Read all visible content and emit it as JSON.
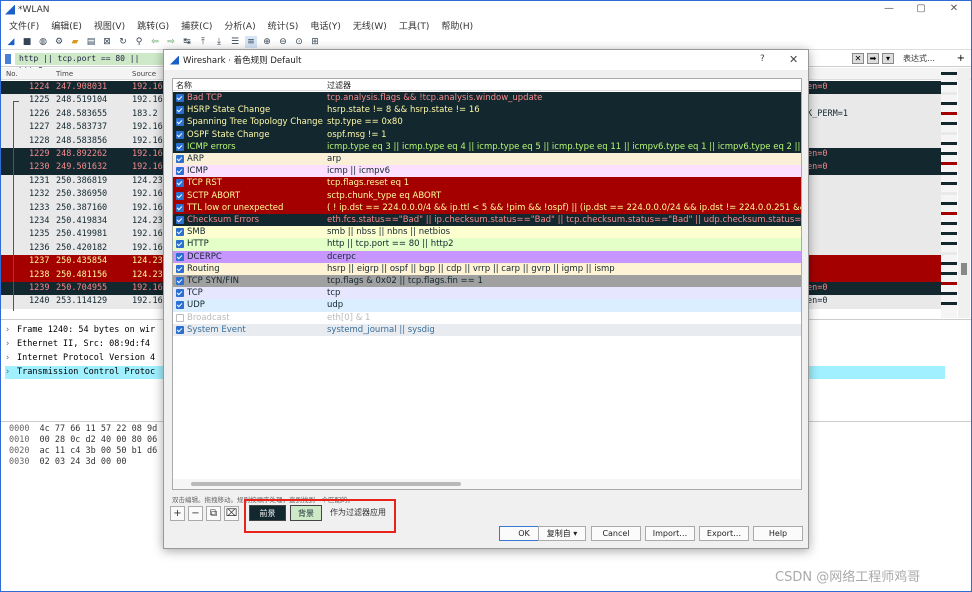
{
  "window": {
    "title": "*WLAN"
  },
  "menu": [
    "文件(F)",
    "编辑(E)",
    "视图(V)",
    "跳转(G)",
    "捕获(C)",
    "分析(A)",
    "统计(S)",
    "电话(Y)",
    "无线(W)",
    "工具(T)",
    "帮助(H)"
  ],
  "filter": {
    "value": "http || tcp.port == 80 || http2",
    "expression_label": "表达式…",
    "plus": "+"
  },
  "packet_headers": {
    "no": "No.",
    "time": "Time",
    "source": "Source"
  },
  "packets": [
    {
      "no": "1224",
      "time": "247.908031",
      "src": "192.16",
      "rx": "en=0",
      "style": "dark"
    },
    {
      "no": "1225",
      "time": "248.519104",
      "src": "192.16",
      "rx": "",
      "style": "gray"
    },
    {
      "no": "1226",
      "time": "248.583655",
      "src": "183.2",
      "rx": "K_PERM=1",
      "style": "gray"
    },
    {
      "no": "1227",
      "time": "248.583737",
      "src": "192.16",
      "rx": "",
      "style": "gray"
    },
    {
      "no": "1228",
      "time": "248.583856",
      "src": "192.16",
      "rx": "",
      "style": "gray"
    },
    {
      "no": "1229",
      "time": "248.892262",
      "src": "192.16",
      "rx": "en=0",
      "style": "dark"
    },
    {
      "no": "1230",
      "time": "249.501632",
      "src": "192.16",
      "rx": "en=0",
      "style": "dark"
    },
    {
      "no": "1231",
      "time": "250.386819",
      "src": "124.23",
      "rx": "",
      "style": "gray"
    },
    {
      "no": "1232",
      "time": "250.386950",
      "src": "192.16",
      "rx": "",
      "style": "gray"
    },
    {
      "no": "1233",
      "time": "250.387160",
      "src": "192.16",
      "rx": "",
      "style": "gray"
    },
    {
      "no": "1234",
      "time": "250.419834",
      "src": "124.23",
      "rx": "",
      "style": "gray"
    },
    {
      "no": "1235",
      "time": "250.419981",
      "src": "192.16",
      "rx": "",
      "style": "gray"
    },
    {
      "no": "1236",
      "time": "250.420182",
      "src": "192.16",
      "rx": "",
      "style": "gray"
    },
    {
      "no": "1237",
      "time": "250.435854",
      "src": "124.23",
      "rx": "",
      "style": "red"
    },
    {
      "no": "1238",
      "time": "250.481156",
      "src": "124.23",
      "rx": "",
      "style": "red"
    },
    {
      "no": "1239",
      "time": "250.704955",
      "src": "192.16",
      "rx": "en=0",
      "style": "dark"
    },
    {
      "no": "1240",
      "time": "253.114129",
      "src": "192.16",
      "rx": "en=0",
      "style": "gray"
    }
  ],
  "details": [
    {
      "text": "Frame 1240: 54 bytes on wir"
    },
    {
      "text": "Ethernet II, Src: 08:9d:f4"
    },
    {
      "text": "Internet Protocol Version 4"
    },
    {
      "text": "Transmission Control Protoc"
    }
  ],
  "hex": [
    {
      "off": "0000",
      "bytes": "4c 77 66 11 57 22 08 9d"
    },
    {
      "off": "0010",
      "bytes": "00 28 0c d2 40 00 80 06"
    },
    {
      "off": "0020",
      "bytes": "ac 11 c4 3b 00 50 b1 d6"
    },
    {
      "off": "0030",
      "bytes": "02 03 24 3d 00 00"
    }
  ],
  "dialog": {
    "title": "Wireshark · 着色规则 Default",
    "help": "?",
    "close": "✕",
    "col_name": "名称",
    "col_filter": "过滤器",
    "hint": "双击编辑。拖拽移动。规则按顺序处理，直到找到一个匹配的。",
    "fg_label": "前景",
    "bg_label": "背景",
    "apply_filter": "作为过滤器应用",
    "buttons": {
      "ok": "OK",
      "copy": "复制自 ▾",
      "cancel": "Cancel",
      "import": "Import…",
      "export": "Export…",
      "help": "Help"
    }
  },
  "rules": [
    {
      "name": "Bad TCP",
      "filter": "tcp.analysis.flags && !tcp.analysis.window_update",
      "fg": "#f78b8b",
      "bg": "#12272e",
      "on": true
    },
    {
      "name": "HSRP State Change",
      "filter": "hsrp.state != 8 && hsrp.state != 16",
      "fg": "#fff9a8",
      "bg": "#12272e",
      "on": true
    },
    {
      "name": "Spanning Tree Topology  Change",
      "filter": "stp.type == 0x80",
      "fg": "#fff9a8",
      "bg": "#12272e",
      "on": true
    },
    {
      "name": "OSPF State Change",
      "filter": "ospf.msg != 1",
      "fg": "#fff9a8",
      "bg": "#12272e",
      "on": true
    },
    {
      "name": "ICMP errors",
      "filter": "icmp.type eq 3 || icmp.type eq 4 || icmp.type eq 5 || icmp.type eq 11 || icmpv6.type eq 1 || icmpv6.type eq 2 || icmpv6.ty",
      "fg": "#b7f774",
      "bg": "#12272e",
      "on": true
    },
    {
      "name": "ARP",
      "filter": "arp",
      "fg": "#12272e",
      "bg": "#faf0d7",
      "on": true
    },
    {
      "name": "ICMP",
      "filter": "icmp || icmpv6",
      "fg": "#12272e",
      "bg": "#fce0ff",
      "on": true
    },
    {
      "name": "TCP RST",
      "filter": "tcp.flags.reset eq 1",
      "fg": "#fffc9c",
      "bg": "#a40000",
      "on": true
    },
    {
      "name": "SCTP ABORT",
      "filter": "sctp.chunk_type eq ABORT",
      "fg": "#fffc9c",
      "bg": "#a40000",
      "on": true
    },
    {
      "name": "TTL low or unexpected",
      "filter": "( ! ip.dst == 224.0.0.0/4 && ip.ttl < 5 && !pim && !ospf) || (ip.dst == 224.0.0.0/24 && ip.dst != 224.0.0.251 && ip.ttl !",
      "fg": "#fffc9c",
      "bg": "#a40000",
      "on": true
    },
    {
      "name": "Checksum Errors",
      "filter": "eth.fcs.status==\"Bad\" || ip.checksum.status==\"Bad\" || tcp.checksum.status==\"Bad\" || udp.checksum.status==\"Bad\" || s",
      "fg": "#f78b8b",
      "bg": "#12272e",
      "on": true
    },
    {
      "name": "SMB",
      "filter": "smb || nbss || nbns || netbios",
      "fg": "#12272e",
      "bg": "#feffd0",
      "on": true
    },
    {
      "name": "HTTP",
      "filter": "http || tcp.port == 80 || http2",
      "fg": "#12272e",
      "bg": "#e4ffc7",
      "on": true
    },
    {
      "name": "DCERPC",
      "filter": "dcerpc",
      "fg": "#12272e",
      "bg": "#c797ff",
      "on": true
    },
    {
      "name": "Routing",
      "filter": "hsrp || eigrp || ospf || bgp || cdp || vrrp || carp || gvrp || igmp || ismp",
      "fg": "#12272e",
      "bg": "#fff3d6",
      "on": true
    },
    {
      "name": "TCP SYN/FIN",
      "filter": "tcp.flags & 0x02 || tcp.flags.fin == 1",
      "fg": "#12272e",
      "bg": "#a0a0a0",
      "on": true
    },
    {
      "name": "TCP",
      "filter": "tcp",
      "fg": "#12272e",
      "bg": "#e7e6ff",
      "on": true
    },
    {
      "name": "UDP",
      "filter": "udp",
      "fg": "#12272e",
      "bg": "#daeeff",
      "on": true
    },
    {
      "name": "Broadcast",
      "filter": "eth[0] & 1",
      "fg": "#bababa",
      "bg": "#ffffff",
      "on": false
    },
    {
      "name": "System Event",
      "filter": "systemd_journal || sysdig",
      "fg": "#3a6e99",
      "bg": "#e8ecf0",
      "on": true
    }
  ],
  "watermark": "CSDN @网络工程师鸡哥"
}
